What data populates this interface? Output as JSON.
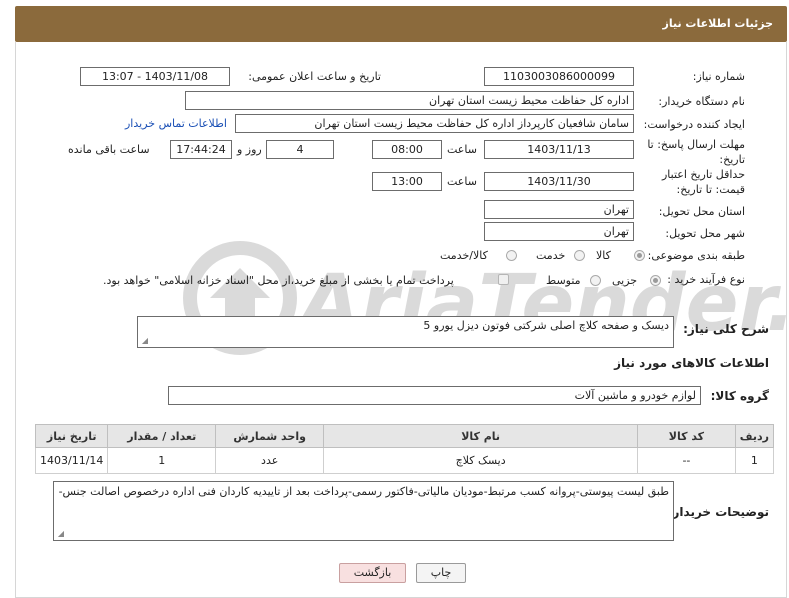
{
  "header": {
    "title": "جزئیات اطلاعات نیاز"
  },
  "form": {
    "need_number_label": "شماره نیاز:",
    "need_number": "1103003086000099",
    "announce_label": "تاریخ و ساعت اعلان عمومی:",
    "announce_value": "1403/11/08 - 13:07",
    "buyer_org_label": "نام دستگاه خریدار:",
    "buyer_org": "اداره کل حفاظت محیط زیست استان تهران",
    "creator_label": "ایجاد کننده درخواست:",
    "creator": "سامان شافعیان کارپرداز اداره کل حفاظت محیط زیست استان تهران",
    "contact_link": "اطلاعات تماس خریدار",
    "reply_deadline_label": "مهلت ارسال پاسخ: تا تاریخ:",
    "reply_date": "1403/11/13",
    "time_label": "ساعت",
    "reply_time": "08:00",
    "days_value": "4",
    "days_label": "روز و",
    "remaining_time": "17:44:24",
    "remaining_label": "ساعت باقی مانده",
    "price_deadline_label": "حداقل تاریخ اعتبار قیمت: تا تاریخ:",
    "price_date": "1403/11/30",
    "price_time": "13:00",
    "province_label": "استان محل تحویل:",
    "province": "تهران",
    "city_label": "شهر محل تحویل:",
    "city": "تهران",
    "category_label": "طبقه بندی موضوعی:",
    "category_options": [
      "کالا",
      "خدمت",
      "کالا/خدمت"
    ],
    "process_label": "نوع فرآیند خرید :",
    "process_options": [
      "جزیی",
      "متوسط"
    ],
    "payment_note": "پرداخت تمام یا بخشی از مبلغ خرید،از محل \"اسناد خزانه اسلامی\" خواهد بود.",
    "description_label": "شرح کلی نیاز:",
    "description": "دیسک و صفحه کلاچ اصلی شرکتی فوتون دیزل یورو 5",
    "goods_section_title": "اطلاعات کالاهای مورد نیاز",
    "goods_group_label": "گروه کالا:",
    "goods_group": "لوازم خودرو و ماشین آلات"
  },
  "table": {
    "headers": [
      "ردیف",
      "کد کالا",
      "نام کالا",
      "واحد شمارش",
      "تعداد / مقدار",
      "تاریخ نیاز"
    ],
    "rows": [
      [
        "1",
        "--",
        "دیسک کلاچ",
        "عدد",
        "1",
        "1403/11/14"
      ]
    ]
  },
  "notes": {
    "label": "توضیحات خریدار:",
    "text": "طبق لیست پیوستی-پروانه کسب مرتبط-مودیان مالیاتی-فاکتور رسمی-پرداخت بعد از تاییدیه کاردان فنی اداره درخصوص اصالت جنس-"
  },
  "buttons": {
    "print": "چاپ",
    "back": "بازگشت"
  },
  "watermark": "AriaTender.neT",
  "colors": {
    "header_bg": "#8b6a3c",
    "link": "#1a4fb5",
    "back_button_bg": "#f8e0e0"
  }
}
